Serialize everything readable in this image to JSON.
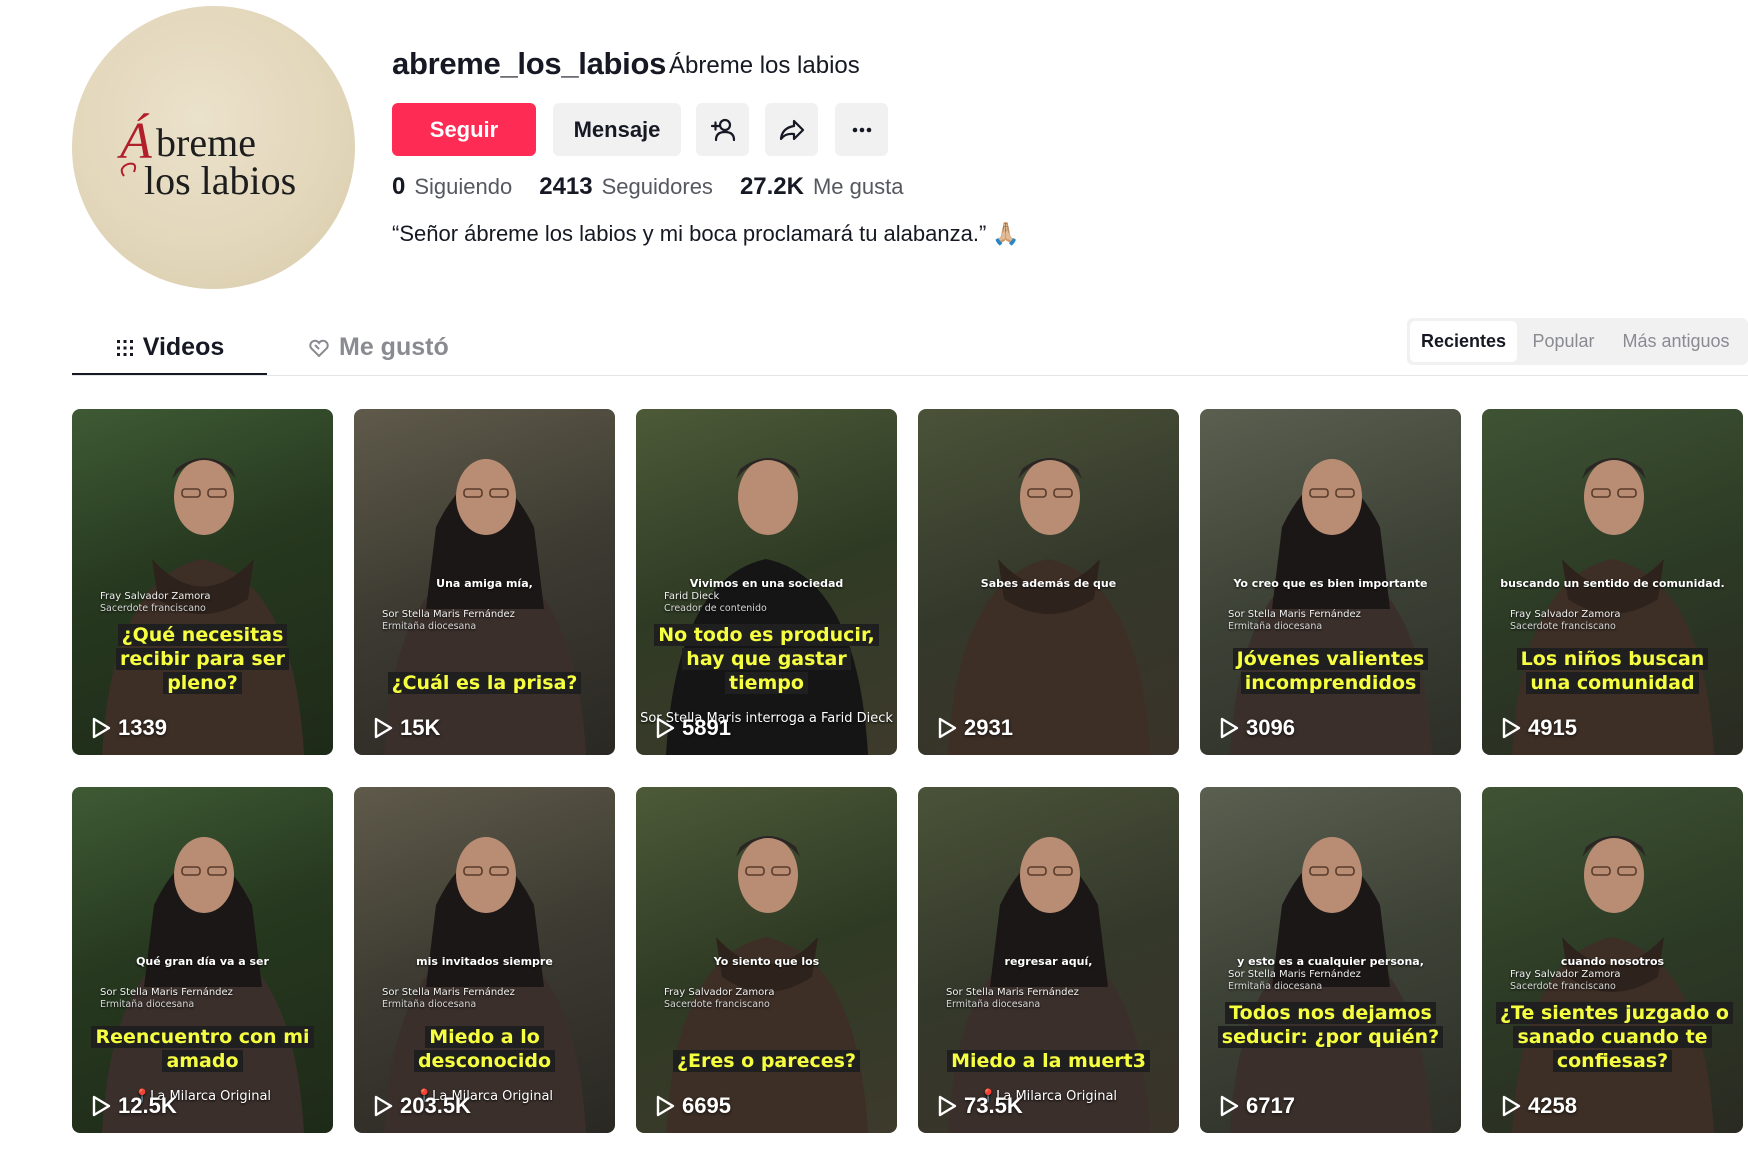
{
  "profile": {
    "username": "abreme_los_labios",
    "nickname": "Ábreme los labios",
    "avatar_text": "Ábreme los labios",
    "follow_label": "Seguir",
    "message_label": "Mensaje",
    "following_count": "0",
    "following_label": "Siguiendo",
    "followers_count": "2413",
    "followers_label": "Seguidores",
    "likes_count": "27.2K",
    "likes_label": "Me gusta",
    "bio": "“Señor ábreme los labios y mi boca proclamará tu alabanza.” 🙏🏼"
  },
  "tabs": {
    "videos_label": "Videos",
    "liked_label": "Me gustó"
  },
  "sort": {
    "recent": "Recientes",
    "popular": "Popular",
    "oldest": "Más antiguos"
  },
  "colors": {
    "accent": "#fe2c55",
    "caption_yellow": "#f6ff3f"
  },
  "videos": [
    {
      "views": "1339",
      "small_text": "",
      "credit_name": "Fray Salvador Zamora",
      "credit_sub": "Sacerdote franciscano",
      "caption": "¿Qué necesitas recibir para ser pleno?",
      "tag": "",
      "subject": "friar"
    },
    {
      "views": "15K",
      "small_text": "Una amiga mía,",
      "credit_name": "Sor Stella Maris Fernández",
      "credit_sub": "Ermitaña diocesana",
      "caption": "¿Cuál es la prisa?",
      "tag": "",
      "subject": "nun"
    },
    {
      "views": "5891",
      "small_text": "Vivimos en una sociedad",
      "credit_name": "Farid Dieck",
      "credit_sub": "Creador de contenido",
      "caption": "No todo es producir, hay que gastar tiempo",
      "tag": "Sor Stella Maris interroga a Farid Dieck",
      "subject": "man"
    },
    {
      "views": "2931",
      "small_text": "Sabes además de que",
      "credit_name": "",
      "credit_sub": "",
      "caption": "",
      "tag": "",
      "subject": "friar"
    },
    {
      "views": "3096",
      "small_text": "Yo creo que es bien importante",
      "credit_name": "Sor Stella Maris Fernández",
      "credit_sub": "Ermitaña diocesana",
      "caption": "Jóvenes valientes incomprendidos",
      "tag": "",
      "subject": "nun"
    },
    {
      "views": "4915",
      "small_text": "buscando un sentido de comunidad.",
      "credit_name": "Fray Salvador Zamora",
      "credit_sub": "Sacerdote franciscano",
      "caption": "Los niños buscan una comunidad",
      "tag": "",
      "subject": "friar"
    },
    {
      "views": "12.5K",
      "small_text": "Qué gran día va a ser",
      "credit_name": "Sor Stella Maris Fernández",
      "credit_sub": "Ermitaña diocesana",
      "caption": "Reencuentro con mi amado",
      "tag": "📍La Milarca Original",
      "subject": "nun"
    },
    {
      "views": "203.5K",
      "small_text": "mis invitados siempre",
      "credit_name": "Sor Stella Maris Fernández",
      "credit_sub": "Ermitaña diocesana",
      "caption": "Miedo a lo desconocido",
      "tag": "📍La Milarca Original",
      "subject": "nun"
    },
    {
      "views": "6695",
      "small_text": "Yo siento que los",
      "credit_name": "Fray Salvador Zamora",
      "credit_sub": "Sacerdote franciscano",
      "caption": "¿Eres o pareces?",
      "tag": "",
      "subject": "friar"
    },
    {
      "views": "73.5K",
      "small_text": "regresar aquí,",
      "credit_name": "Sor Stella Maris Fernández",
      "credit_sub": "Ermitaña diocesana",
      "caption": "Miedo a la muert3",
      "tag": "📍La Milarca Original",
      "subject": "nun"
    },
    {
      "views": "6717",
      "small_text": "y esto es a cualquier persona,",
      "credit_name": "Sor Stella Maris Fernández",
      "credit_sub": "Ermitaña diocesana",
      "caption": "Todos nos dejamos seducir: ¿por quién?",
      "tag": "",
      "subject": "nun"
    },
    {
      "views": "4258",
      "small_text": "cuando nosotros",
      "credit_name": "Fray Salvador Zamora",
      "credit_sub": "Sacerdote franciscano",
      "caption": "¿Te sientes juzgado o sanado cuando te confiesas?",
      "tag": "",
      "subject": "friar"
    }
  ]
}
